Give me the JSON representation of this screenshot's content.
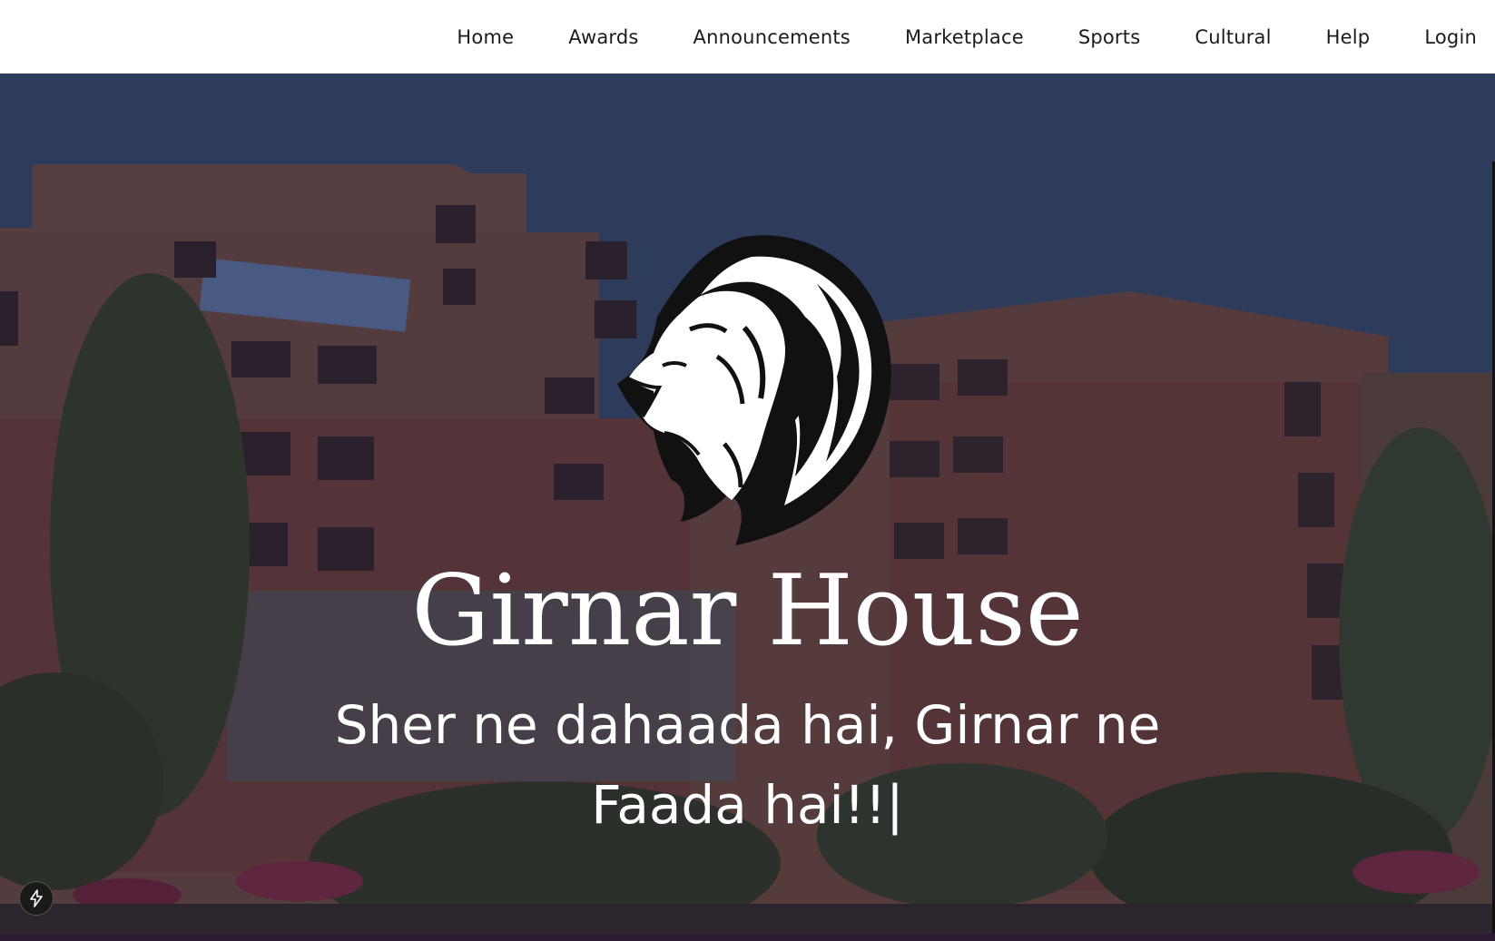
{
  "nav": {
    "items": [
      "Home",
      "Awards",
      "Announcements",
      "Marketplace",
      "Sports",
      "Cultural",
      "Help",
      "Login"
    ]
  },
  "hero": {
    "title": "Girnar House",
    "tagline": "Sher ne dahaada hai, Girnar ne Faada hai!!",
    "caret": "|",
    "logo_icon": "lion-head-icon",
    "background": "girnar-house-building-photo"
  },
  "widgets": {
    "dev_indicator_icon": "lightning-bolt-icon"
  },
  "colors": {
    "navbar_bg": "#ffffff",
    "nav_text": "#1b1b1b",
    "hero_text": "#ffffff",
    "overlay": "#2a2040"
  }
}
